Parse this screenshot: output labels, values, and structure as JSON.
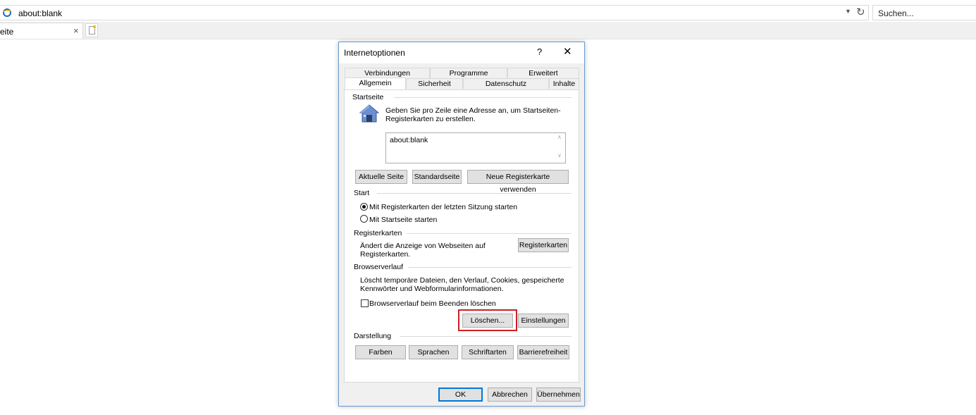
{
  "browser": {
    "address": "about:blank",
    "search_placeholder": "Suchen...",
    "tab_title": "eite",
    "tab_close": "×"
  },
  "dialog": {
    "title": "Internetoptionen",
    "help": "?",
    "close": "✕",
    "tabs_back": [
      "Verbindungen",
      "Programme",
      "Erweitert"
    ],
    "tabs_front": [
      "Allgemein",
      "Sicherheit",
      "Datenschutz",
      "Inhalte"
    ],
    "active_tab": "Allgemein",
    "startseite": {
      "heading": "Startseite",
      "description": "Geben Sie pro Zeile eine Adresse an, um Startseiten-Registerkarten zu erstellen.",
      "value": "about:blank",
      "buttons": [
        "Aktuelle Seite",
        "Standardseite",
        "Neue Registerkarte verwenden"
      ]
    },
    "start": {
      "heading": "Start",
      "options": [
        "Mit Registerkarten der letzten Sitzung starten",
        "Mit Startseite starten"
      ],
      "selected": 0
    },
    "registerkarten": {
      "heading": "Registerkarten",
      "description": "Ändert die Anzeige von Webseiten auf Registerkarten.",
      "button": "Registerkarten"
    },
    "browserverlauf": {
      "heading": "Browserverlauf",
      "description": "Löscht temporäre Dateien, den Verlauf, Cookies, gespeicherte Kennwörter und Webformularinformationen.",
      "checkbox": "Browserverlauf beim Beenden löschen",
      "checked": false,
      "delete_button": "Löschen...",
      "settings_button": "Einstellungen"
    },
    "darstellung": {
      "heading": "Darstellung",
      "buttons": [
        "Farben",
        "Sprachen",
        "Schriftarten",
        "Barrierefreiheit"
      ]
    },
    "footer": {
      "ok": "OK",
      "cancel": "Abbrechen",
      "apply": "Übernehmen"
    }
  },
  "colors": {
    "highlight": "#cc1f26",
    "dialog_border": "#6b9bd1",
    "default_button_border": "#0078d7"
  }
}
